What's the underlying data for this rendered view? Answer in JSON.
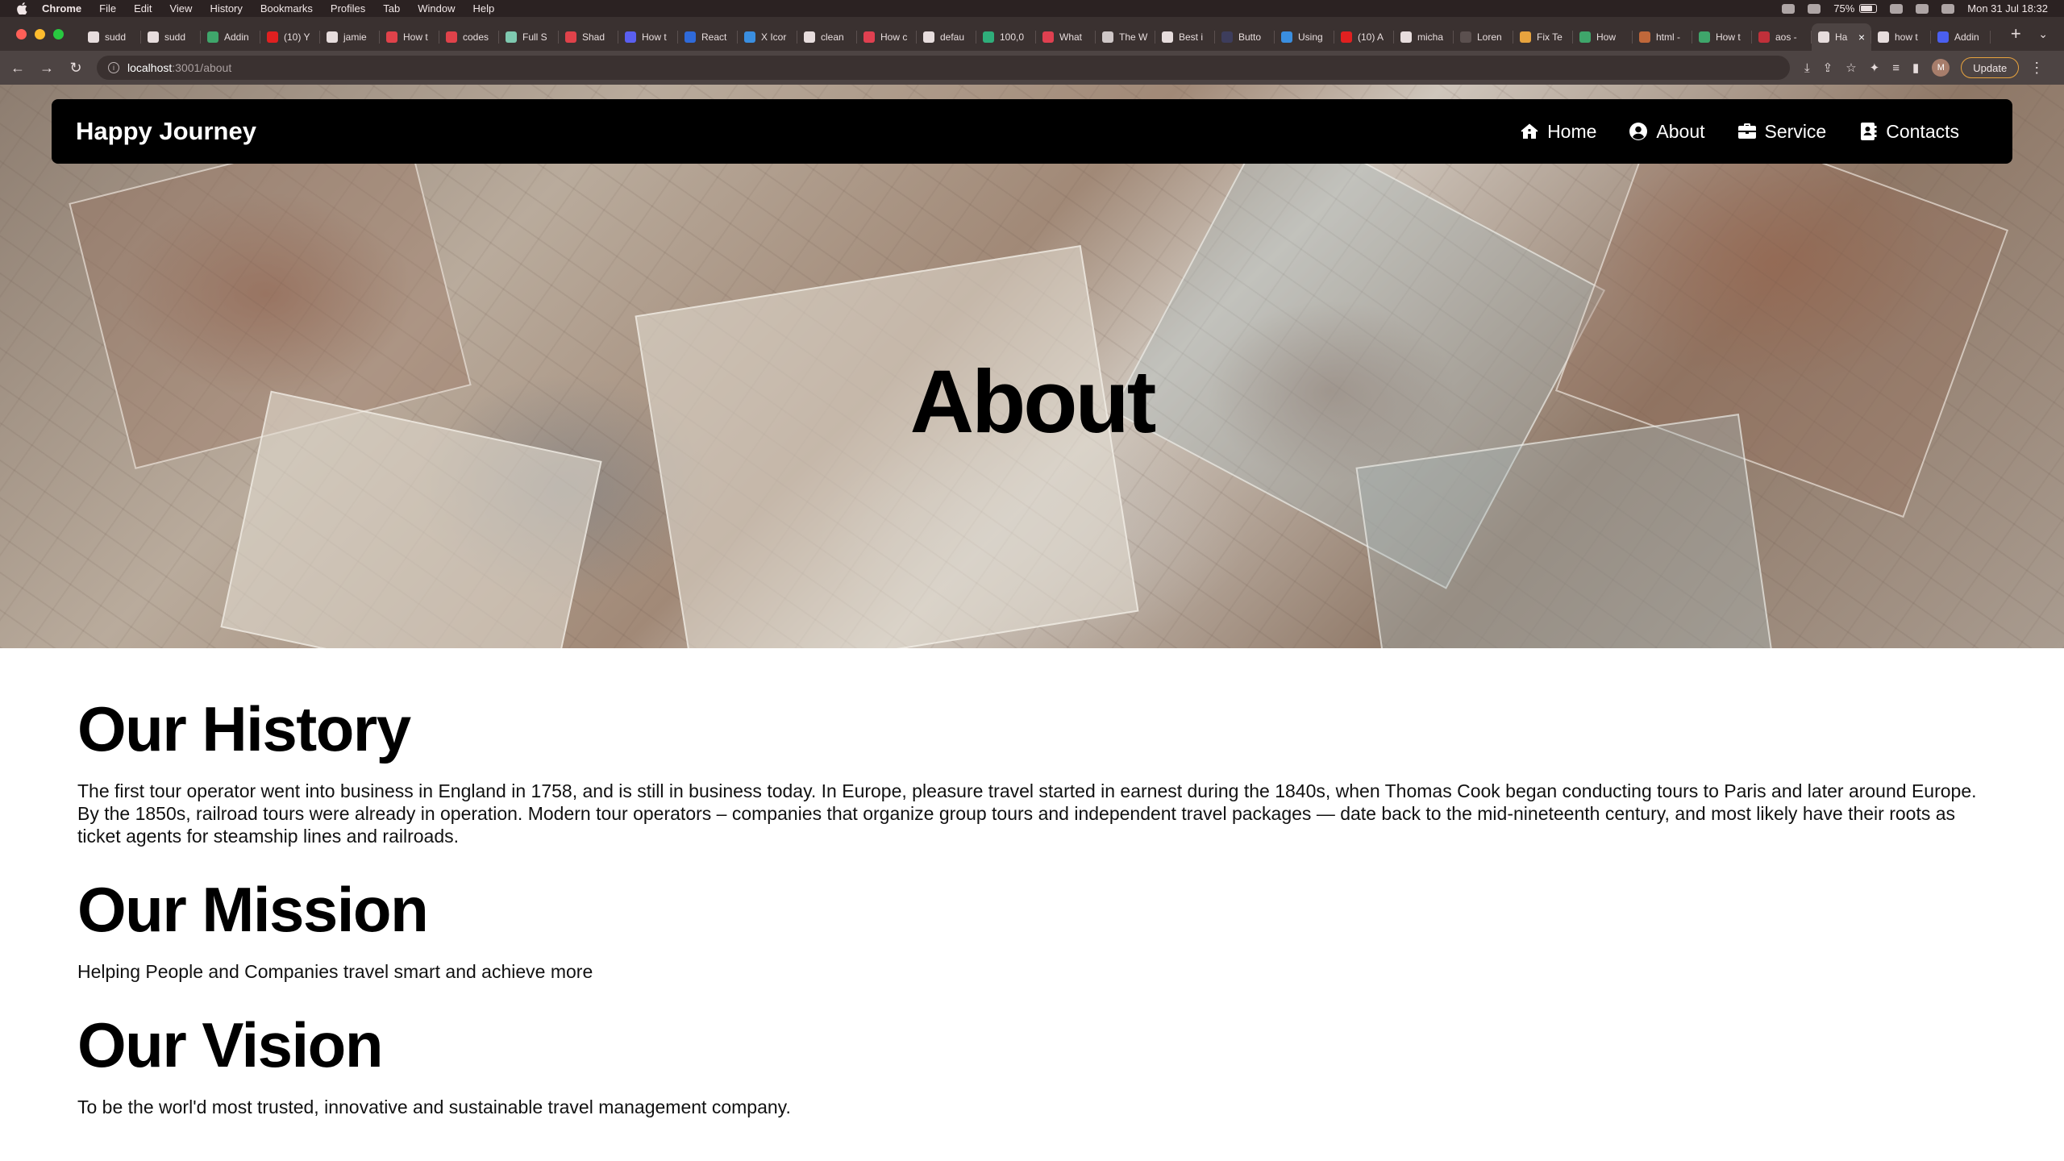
{
  "menubar": {
    "app_name": "Chrome",
    "items": [
      "File",
      "Edit",
      "View",
      "History",
      "Bookmarks",
      "Profiles",
      "Tab",
      "Window",
      "Help"
    ],
    "battery": "75%",
    "datetime": "Mon 31 Jul  18:32"
  },
  "tabs": [
    {
      "label": "sudd",
      "color": "#e7dddd"
    },
    {
      "label": "sudd",
      "color": "#e7dddd"
    },
    {
      "label": "Addin",
      "color": "#3fa66b"
    },
    {
      "label": "(10) Y",
      "color": "#e02020"
    },
    {
      "label": "jamie",
      "color": "#e7dddd"
    },
    {
      "label": "How t",
      "color": "#e0424a"
    },
    {
      "label": "codes",
      "color": "#e0424a"
    },
    {
      "label": "Full S",
      "color": "#7fc9b0"
    },
    {
      "label": "Shad",
      "color": "#e0424a"
    },
    {
      "label": "How t",
      "color": "#5a5ff0"
    },
    {
      "label": "React",
      "color": "#2f6ad9"
    },
    {
      "label": "X Icor",
      "color": "#3a8ee0"
    },
    {
      "label": "clean",
      "color": "#e7dddd"
    },
    {
      "label": "How c",
      "color": "#e04050"
    },
    {
      "label": "defau",
      "color": "#e7dddd"
    },
    {
      "label": "100,0",
      "color": "#2fae7a"
    },
    {
      "label": "What",
      "color": "#e04050"
    },
    {
      "label": "The W",
      "color": "#cfc7c7"
    },
    {
      "label": "Best i",
      "color": "#e7dddd"
    },
    {
      "label": "Butto",
      "color": "#3d3d5c"
    },
    {
      "label": "Using",
      "color": "#3a8ee0"
    },
    {
      "label": "(10) A",
      "color": "#e02020"
    },
    {
      "label": "micha",
      "color": "#e7dddd"
    },
    {
      "label": "Loren",
      "color": "#5b504f"
    },
    {
      "label": "Fix Te",
      "color": "#e7a33e"
    },
    {
      "label": "How",
      "color": "#3fa66b"
    },
    {
      "label": "html -",
      "color": "#c0683a"
    },
    {
      "label": "How t",
      "color": "#3fa66b"
    },
    {
      "label": "aos -",
      "color": "#c0303a"
    },
    {
      "label": "Ha",
      "color": "#e7dddd",
      "active": true
    },
    {
      "label": "how t",
      "color": "#e7dddd"
    },
    {
      "label": "Addin",
      "color": "#4a5ff0"
    }
  ],
  "toolbar": {
    "url_host": "localhost",
    "url_path": ":3001/about",
    "update_label": "Update",
    "profile_initial": "M"
  },
  "navbar": {
    "brand": "Happy Journey",
    "links": [
      {
        "label": "Home",
        "icon": "house-icon"
      },
      {
        "label": "About",
        "icon": "user-circle-icon"
      },
      {
        "label": "Service",
        "icon": "briefcase-icon"
      },
      {
        "label": "Contacts",
        "icon": "address-book-icon"
      }
    ]
  },
  "hero": {
    "title": "About"
  },
  "sections": {
    "history": {
      "title": "Our History",
      "text": "The first tour operator went into business in England in 1758, and is still in business today. In Europe, pleasure travel started in earnest during the 1840s, when Thomas Cook began conducting tours to Paris and later around Europe. By the 1850s, railroad tours were already in operation. Modern tour operators – companies that organize group tours and independent travel packages — date back to the mid-nineteenth century, and most likely have their roots as ticket agents for steamship lines and railroads."
    },
    "mission": {
      "title": "Our Mission",
      "text": "Helping People and Companies travel smart and achieve more"
    },
    "vision": {
      "title": "Our Vision",
      "text": "To be the worl'd most trusted, innovative and sustainable travel management company."
    }
  }
}
